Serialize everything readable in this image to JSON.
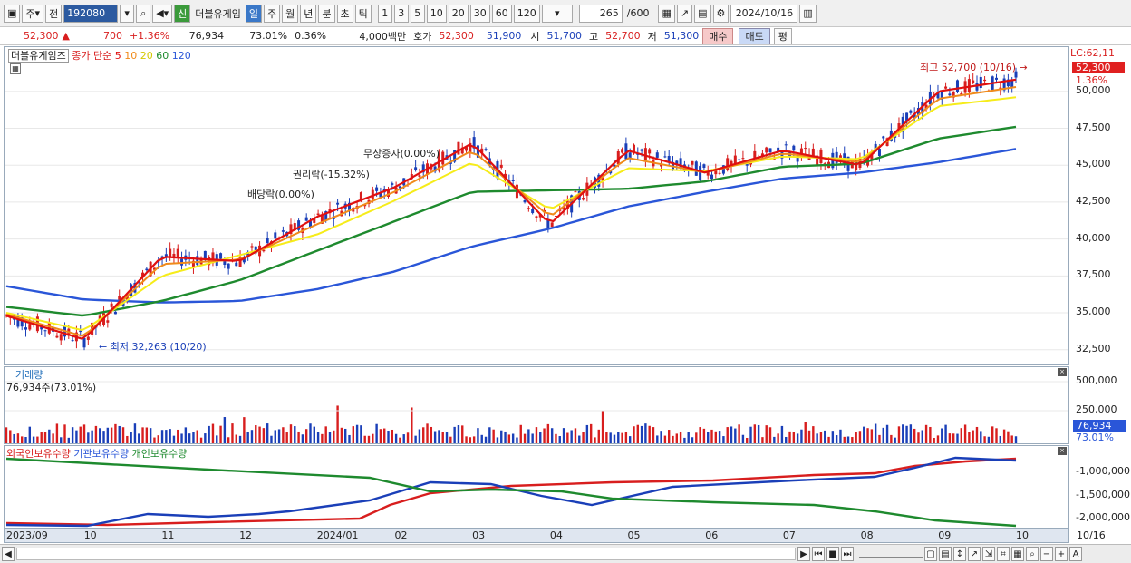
{
  "toolbar": {
    "type_label": "주",
    "prev_label": "전",
    "code": "192080",
    "new_badge": "신",
    "name": "더블유게임",
    "periods": [
      "일",
      "주",
      "월",
      "년",
      "분",
      "초",
      "틱"
    ],
    "active_period": "일",
    "counts": [
      "1",
      "3",
      "5",
      "10",
      "20",
      "30",
      "60",
      "120"
    ],
    "view_count": "265",
    "view_total": "/600",
    "date": "2024/10/16"
  },
  "quote": {
    "price": "52,300",
    "arrow": "▲",
    "change": "700",
    "change_pct": "+1.36%",
    "volume": "76,934",
    "vol_ratio": "73.01%",
    "turnover_pct": "0.36%",
    "amount": "4,000백만",
    "bid_label": "호가",
    "ask_price": "52,300",
    "bid_price": "51,900",
    "open_label": "시",
    "open": "51,700",
    "high_label": "고",
    "high": "52,700",
    "low_label": "저",
    "low": "51,300",
    "buy_label": "매수",
    "sell_label": "매도",
    "eval_label": "평"
  },
  "legend": {
    "name": "더블유게임즈",
    "ma_label": "종가 단순",
    "ma5": "5",
    "ma10": "10",
    "ma20": "20",
    "ma60": "60",
    "ma120": "120"
  },
  "annotations": {
    "max": "최고 52,700 (10/16)",
    "min": "최저 32,263 (10/20)",
    "dividend": "배당락(0.00%)",
    "rights": "권리락(-15.32%)",
    "bonus": "무상증자(0.00%)"
  },
  "price_axis": {
    "lc": "LC:62,11",
    "current": "52,300",
    "current_pct": "1.36%",
    "ticks": [
      "50,000",
      "47,500",
      "45,000",
      "42,500",
      "40,000",
      "37,500",
      "35,000",
      "32,500"
    ]
  },
  "volume_pane": {
    "title": "거래량",
    "value": "76,934주(73.01%)",
    "ticks": [
      "500,000",
      "250,000"
    ],
    "current": "76,934",
    "current_pct": "73.01%"
  },
  "holdings_pane": {
    "foreign": "외국인보유수량",
    "inst": "기관보유수량",
    "indiv": "개인보유수량",
    "ticks": [
      "-1,000,000",
      "-1,500,000",
      "-2,000,000"
    ]
  },
  "date_axis": {
    "labels": [
      "2023/09",
      "10",
      "11",
      "12",
      "2024/01",
      "02",
      "03",
      "04",
      "05",
      "06",
      "07",
      "08",
      "09",
      "10"
    ],
    "end": "10/16"
  },
  "colors": {
    "up": "#d81e1e",
    "down": "#1a3fb8",
    "ma5": "#e01010",
    "ma10": "#f08a1a",
    "ma20": "#f6ec1a",
    "ma60": "#1e8a2e",
    "ma120": "#2a56d8"
  },
  "chart_data": {
    "type": "line",
    "ylim": [
      31500,
      53000
    ],
    "x": [
      "2023/09",
      "10",
      "11",
      "12",
      "2024/01",
      "02",
      "03",
      "04",
      "05",
      "06",
      "07",
      "08",
      "09",
      "10"
    ],
    "series": [
      {
        "name": "5",
        "values": [
          34800,
          33200,
          38800,
          38500,
          41500,
          43500,
          46500,
          41000,
          46000,
          44500,
          46000,
          45000,
          50000,
          50800
        ]
      },
      {
        "name": "10",
        "values": [
          34900,
          33400,
          38300,
          38600,
          41000,
          43200,
          46000,
          41500,
          45500,
          44500,
          45800,
          45200,
          49500,
          50300
        ]
      },
      {
        "name": "20",
        "values": [
          35000,
          33800,
          37500,
          38900,
          40300,
          42600,
          45200,
          42000,
          44800,
          44600,
          45600,
          45400,
          49000,
          49600
        ]
      },
      {
        "name": "60",
        "values": [
          35400,
          34800,
          35800,
          37200,
          39200,
          41200,
          43200,
          43300,
          43400,
          43900,
          44900,
          45100,
          46800,
          47600
        ]
      },
      {
        "name": "120",
        "values": [
          36800,
          35900,
          35700,
          35800,
          36600,
          37800,
          39500,
          40700,
          42200,
          43200,
          44100,
          44500,
          45200,
          46100
        ]
      }
    ]
  }
}
